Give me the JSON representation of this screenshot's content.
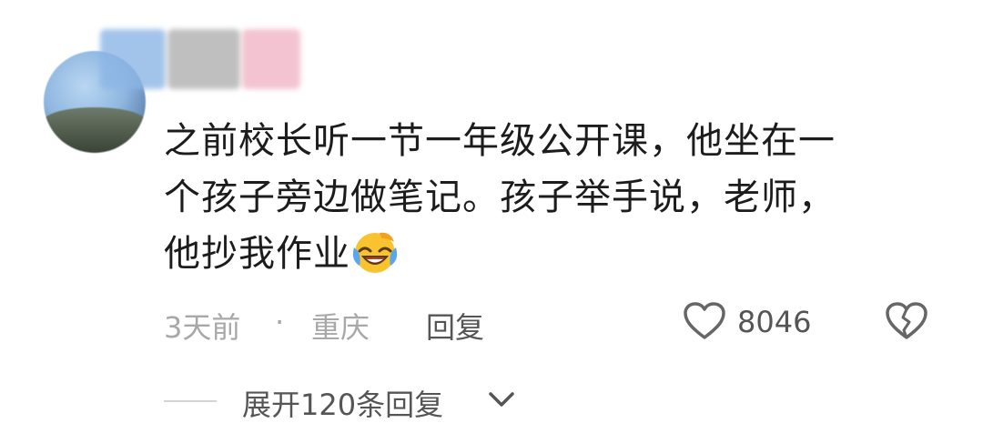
{
  "comment": {
    "lines": [
      "之前校长听一节一年级公开课，他坐在一",
      "个孩子旁边做笔记。孩子举手说，老师，",
      "他抄我作业"
    ],
    "emoji": "laughing-crying-emoji"
  },
  "meta": {
    "time": "3天前",
    "separator": "·",
    "location": "重庆",
    "reply_label": "回复",
    "like_count": "8046"
  },
  "expand": {
    "label": "展开120条回复"
  },
  "icons": {
    "like": "heart-outline-icon",
    "dislike": "broken-heart-icon",
    "expand": "chevron-down-icon"
  }
}
